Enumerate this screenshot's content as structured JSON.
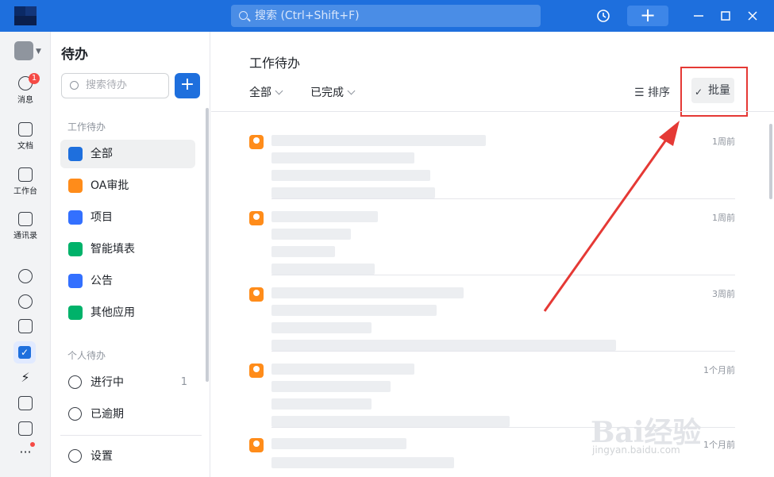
{
  "titlebar": {
    "search_placeholder": "搜索 (Ctrl+Shift+F)",
    "add_label": "+"
  },
  "rail": {
    "message_label": "消息",
    "message_badge": "1",
    "docs_label": "文档",
    "workspace_label": "工作台",
    "contacts_label": "通讯录",
    "more_label": "···"
  },
  "sidebar": {
    "title": "待办",
    "search_placeholder": "搜索待办",
    "plus_label": "+",
    "work_section": "工作待办",
    "work_items": [
      {
        "label": "全部",
        "color": "#1e6fdd"
      },
      {
        "label": "OA审批",
        "color": "#ff8c1a"
      },
      {
        "label": "项目",
        "color": "#3370ff"
      },
      {
        "label": "智能填表",
        "color": "#00b26a"
      },
      {
        "label": "公告",
        "color": "#3370ff"
      },
      {
        "label": "其他应用",
        "color": "#00b26a"
      }
    ],
    "personal_section": "个人待办",
    "personal_items": [
      {
        "label": "进行中",
        "count": "1"
      },
      {
        "label": "已逾期",
        "count": ""
      }
    ],
    "settings_label": "设置"
  },
  "main": {
    "title": "工作待办",
    "filter_all": "全部",
    "filter_done": "已完成",
    "sort_label": "排序",
    "batch_label": "批量",
    "tasks": [
      {
        "time": "1周前"
      },
      {
        "time": "1周前"
      },
      {
        "time": "3周前"
      },
      {
        "time": "1个月前"
      },
      {
        "time": "1个月前"
      }
    ]
  },
  "watermark": {
    "text": "Bai经验",
    "url": "jingyan.baidu.com"
  }
}
